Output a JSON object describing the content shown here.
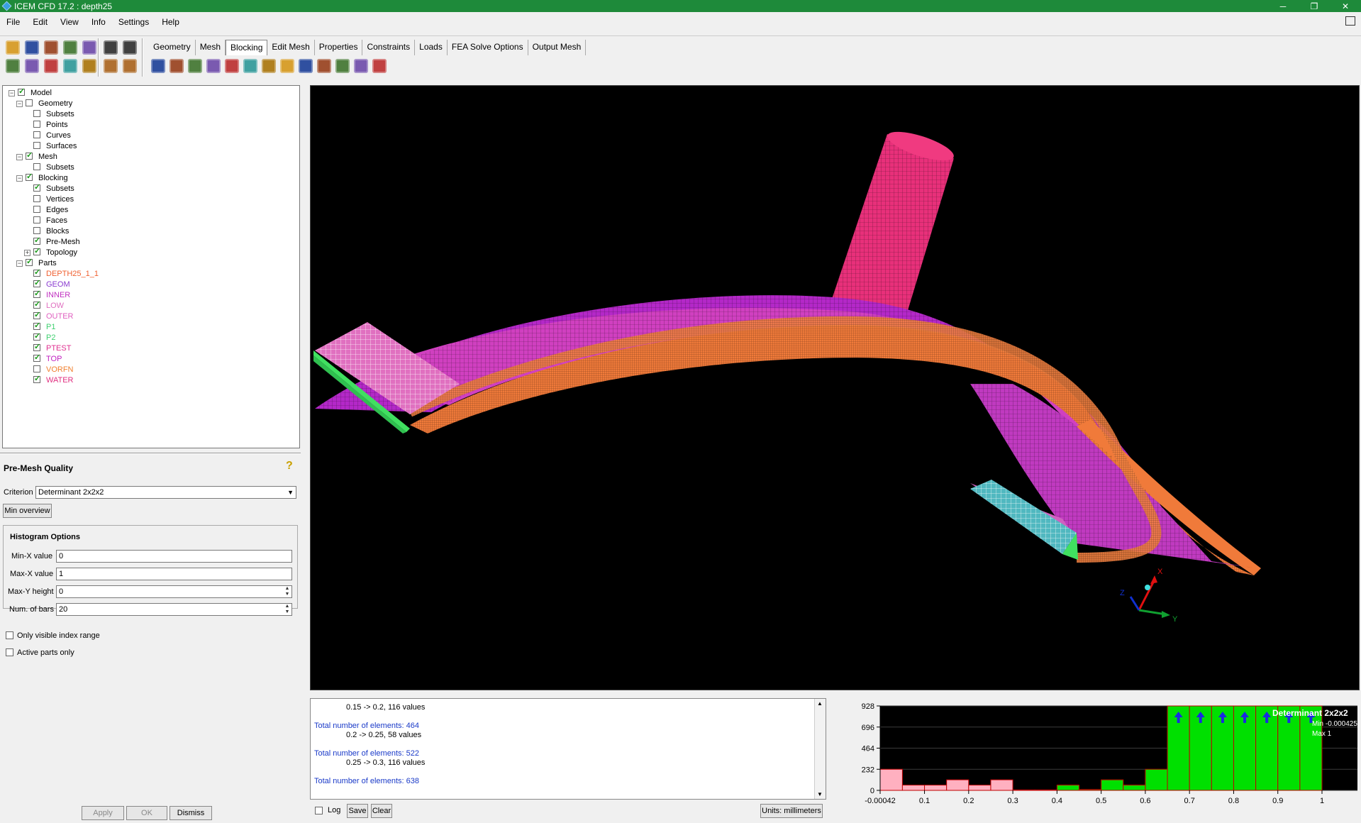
{
  "window": {
    "title": "ICEM CFD 17.2 : depth25",
    "controls": [
      "─",
      "❐",
      "✕"
    ]
  },
  "menu": [
    "File",
    "Edit",
    "View",
    "Info",
    "Settings",
    "Help"
  ],
  "tabs": [
    {
      "label": "Geometry",
      "active": false
    },
    {
      "label": "Mesh",
      "active": false
    },
    {
      "label": "Blocking",
      "active": true
    },
    {
      "label": "Edit Mesh",
      "active": false
    },
    {
      "label": "Properties",
      "active": false
    },
    {
      "label": "Constraints",
      "active": false
    },
    {
      "label": "Loads",
      "active": false
    },
    {
      "label": "FEA Solve Options",
      "active": false
    },
    {
      "label": "Output Mesh",
      "active": false
    }
  ],
  "toolbar_icons": {
    "file_row1": [
      "open-folder-icon",
      "save-icon",
      "save-project-icon",
      "open-geometry-icon",
      "save-geometry-icon"
    ],
    "file_row2": [
      "fit-window-icon",
      "zoom-box-icon",
      "measure-icon",
      "distance-icon",
      "select-icon"
    ],
    "undo_row1": [
      "undo-icon",
      "redo-icon"
    ],
    "undo_row2": [
      "display-toggle-icon",
      "solid-display-icon"
    ],
    "blocking_tools": [
      "create-block-icon",
      "split-block-icon",
      "merge-vertices-icon",
      "edit-block-icon",
      "associate-icon",
      "move-vertex-icon",
      "transform-blocks-icon",
      "edit-edge-icon",
      "pre-mesh-params-icon",
      "pre-mesh-quality-icon",
      "pre-mesh-smooth-icon",
      "check-blocks-icon",
      "delete-block-icon"
    ]
  },
  "tree": {
    "model": "Model",
    "geometry": {
      "label": "Geometry",
      "children": [
        "Subsets",
        "Points",
        "Curves",
        "Surfaces"
      ]
    },
    "mesh": {
      "label": "Mesh",
      "children": [
        "Subsets"
      ]
    },
    "blocking": {
      "label": "Blocking",
      "children": [
        {
          "label": "Subsets",
          "checked": true
        },
        {
          "label": "Vertices",
          "checked": false
        },
        {
          "label": "Edges",
          "checked": false
        },
        {
          "label": "Faces",
          "checked": false
        },
        {
          "label": "Blocks",
          "checked": false
        },
        {
          "label": "Pre-Mesh",
          "checked": true
        },
        {
          "label": "Topology",
          "checked": true
        }
      ]
    },
    "parts": {
      "label": "Parts",
      "children": [
        {
          "label": "DEPTH25_1_1",
          "color": "#f06030",
          "checked": true
        },
        {
          "label": "GEOM",
          "color": "#8a3ad0",
          "checked": true
        },
        {
          "label": "INNER",
          "color": "#c030c0",
          "checked": true
        },
        {
          "label": "LOW",
          "color": "#e070c0",
          "checked": true
        },
        {
          "label": "OUTER",
          "color": "#e060c0",
          "checked": true
        },
        {
          "label": "P1",
          "color": "#40d070",
          "checked": true
        },
        {
          "label": "P2",
          "color": "#40d070",
          "checked": true
        },
        {
          "label": "PTEST",
          "color": "#e03090",
          "checked": true
        },
        {
          "label": "TOP",
          "color": "#c020c0",
          "checked": true
        },
        {
          "label": "VORFN",
          "color": "#f08030",
          "checked": false
        },
        {
          "label": "WATER",
          "color": "#e03080",
          "checked": true
        }
      ]
    }
  },
  "premesh": {
    "title": "Pre-Mesh Quality",
    "criterion_label": "Criterion",
    "criterion_value": "Determinant 2x2x2",
    "min_overview": "Min overview",
    "histogram_title": "Histogram Options",
    "min_x_label": "Min-X value",
    "min_x_value": "0",
    "max_x_label": "Max-X value",
    "max_x_value": "1",
    "max_y_label": "Max-Y height",
    "max_y_value": "0",
    "num_bars_label": "Num. of bars",
    "num_bars_value": "20",
    "only_visible": "Only visible index range",
    "active_parts": "Active parts only",
    "apply": "Apply",
    "ok": "OK",
    "dismiss": "Dismiss"
  },
  "log": {
    "lines": [
      {
        "text": "0.15 -> 0.2, 116 values",
        "total": false
      },
      {
        "text": "Total number of elements: 464",
        "total": true
      },
      {
        "text": "0.2 -> 0.25, 58 values",
        "total": false
      },
      {
        "text": "Total number of elements: 522",
        "total": true
      },
      {
        "text": "0.25 -> 0.3, 116 values",
        "total": false
      },
      {
        "text": "Total number of elements: 638",
        "total": true
      }
    ],
    "log_label": "Log",
    "save": "Save",
    "clear": "Clear",
    "units": "Units: millimeters"
  },
  "axes_triad": {
    "x": "X",
    "y": "Y",
    "z": "Z"
  },
  "chart_data": {
    "type": "bar",
    "title": "Determinant 2x2x2",
    "annotations": [
      "Min -0.000425",
      "Max 1"
    ],
    "x_ticks": [
      "-0.00042",
      "0.1",
      "0.2",
      "0.3",
      "0.4",
      "0.5",
      "0.6",
      "0.7",
      "0.8",
      "0.9",
      "1"
    ],
    "y_ticks": [
      "0",
      "232",
      "464",
      "696",
      "928"
    ],
    "ylim": [
      0,
      928
    ],
    "xlim": [
      -0.000425,
      1
    ],
    "bars": [
      {
        "x0": -0.000425,
        "x1": 0.05,
        "value": 232,
        "color": "#ffb0c0"
      },
      {
        "x0": 0.05,
        "x1": 0.1,
        "value": 58,
        "color": "#ffb0c0"
      },
      {
        "x0": 0.1,
        "x1": 0.15,
        "value": 58,
        "color": "#ffb0c0"
      },
      {
        "x0": 0.15,
        "x1": 0.2,
        "value": 116,
        "color": "#ffb0c0"
      },
      {
        "x0": 0.2,
        "x1": 0.25,
        "value": 58,
        "color": "#ffb0c0"
      },
      {
        "x0": 0.25,
        "x1": 0.3,
        "value": 116,
        "color": "#ffb0c0"
      },
      {
        "x0": 0.3,
        "x1": 0.35,
        "value": 5,
        "color": "#00e000"
      },
      {
        "x0": 0.35,
        "x1": 0.4,
        "value": 5,
        "color": "#00e000"
      },
      {
        "x0": 0.4,
        "x1": 0.45,
        "value": 58,
        "color": "#00e000"
      },
      {
        "x0": 0.45,
        "x1": 0.5,
        "value": 10,
        "color": "#00e000"
      },
      {
        "x0": 0.5,
        "x1": 0.55,
        "value": 116,
        "color": "#00e000"
      },
      {
        "x0": 0.55,
        "x1": 0.6,
        "value": 58,
        "color": "#00e000"
      },
      {
        "x0": 0.6,
        "x1": 0.65,
        "value": 232,
        "color": "#00e000"
      },
      {
        "x0": 0.65,
        "x1": 0.7,
        "value": 928,
        "color": "#00e000",
        "overflow": true
      },
      {
        "x0": 0.7,
        "x1": 0.75,
        "value": 928,
        "color": "#00e000",
        "overflow": true
      },
      {
        "x0": 0.75,
        "x1": 0.8,
        "value": 928,
        "color": "#00e000",
        "overflow": true
      },
      {
        "x0": 0.8,
        "x1": 0.85,
        "value": 928,
        "color": "#00e000",
        "overflow": true
      },
      {
        "x0": 0.85,
        "x1": 0.9,
        "value": 928,
        "color": "#00e000",
        "overflow": true
      },
      {
        "x0": 0.9,
        "x1": 0.95,
        "value": 928,
        "color": "#00e000",
        "overflow": true
      },
      {
        "x0": 0.95,
        "x1": 1,
        "value": 928,
        "color": "#00e000",
        "overflow": true
      }
    ],
    "grid": true
  }
}
